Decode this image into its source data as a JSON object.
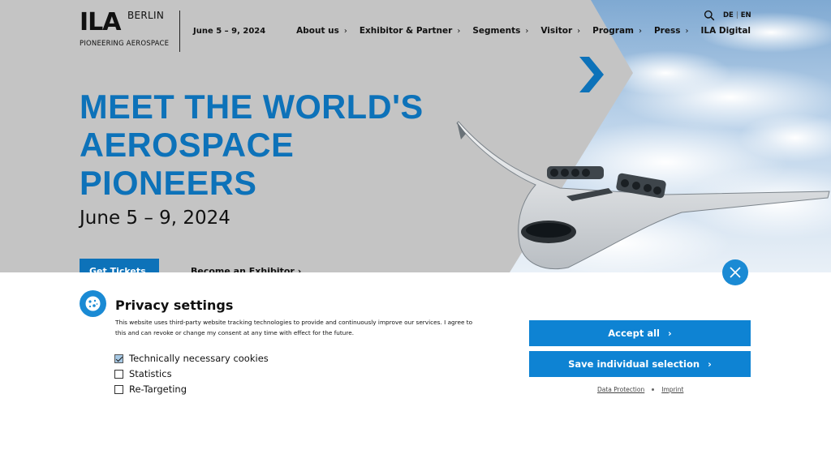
{
  "header": {
    "logo_ila": "ILA",
    "logo_city": "BERLIN",
    "logo_tagline": "PIONEERING AEROSPACE",
    "dates": "June 5 – 9, 2024",
    "lang_de": "DE",
    "lang_sep": "|",
    "lang_en": "EN"
  },
  "nav": {
    "items": [
      {
        "label": "About us",
        "chevron": "›"
      },
      {
        "label": "Exhibitor & Partner",
        "chevron": "›"
      },
      {
        "label": "Segments",
        "chevron": "›"
      },
      {
        "label": "Visitor",
        "chevron": "›"
      },
      {
        "label": "Program",
        "chevron": "›"
      },
      {
        "label": "Press",
        "chevron": "›"
      },
      {
        "label": "ILA Digital"
      }
    ]
  },
  "hero": {
    "headline": [
      "MEET THE WORLD'S",
      "AEROSPACE",
      "PIONEERS"
    ],
    "date": "June 5 – 9, 2024",
    "cta_tickets": "Get Tickets",
    "cta_exhibitor": "Become an Exhibitor",
    "cta_exhibitor_chevron": "›"
  },
  "privacy": {
    "title": "Privacy settings",
    "text": "This website uses third-party website tracking technologies to provide and continuously improve our services. I agree to this and can revoke or change my consent at any time with effect for the future.",
    "options": [
      {
        "label": "Technically necessary cookies",
        "checked": true
      },
      {
        "label": "Statistics",
        "checked": false
      },
      {
        "label": "Re-Targeting",
        "checked": false
      }
    ],
    "accept_all": "Accept all",
    "save_selection": "Save individual selection",
    "button_chevron": "›",
    "link_data_protection": "Data Protection",
    "link_imprint": "Imprint"
  },
  "colors": {
    "brand_blue": "#0d72b9",
    "button_blue": "#0e83d3",
    "hero_grey": "#c4c4c4"
  }
}
